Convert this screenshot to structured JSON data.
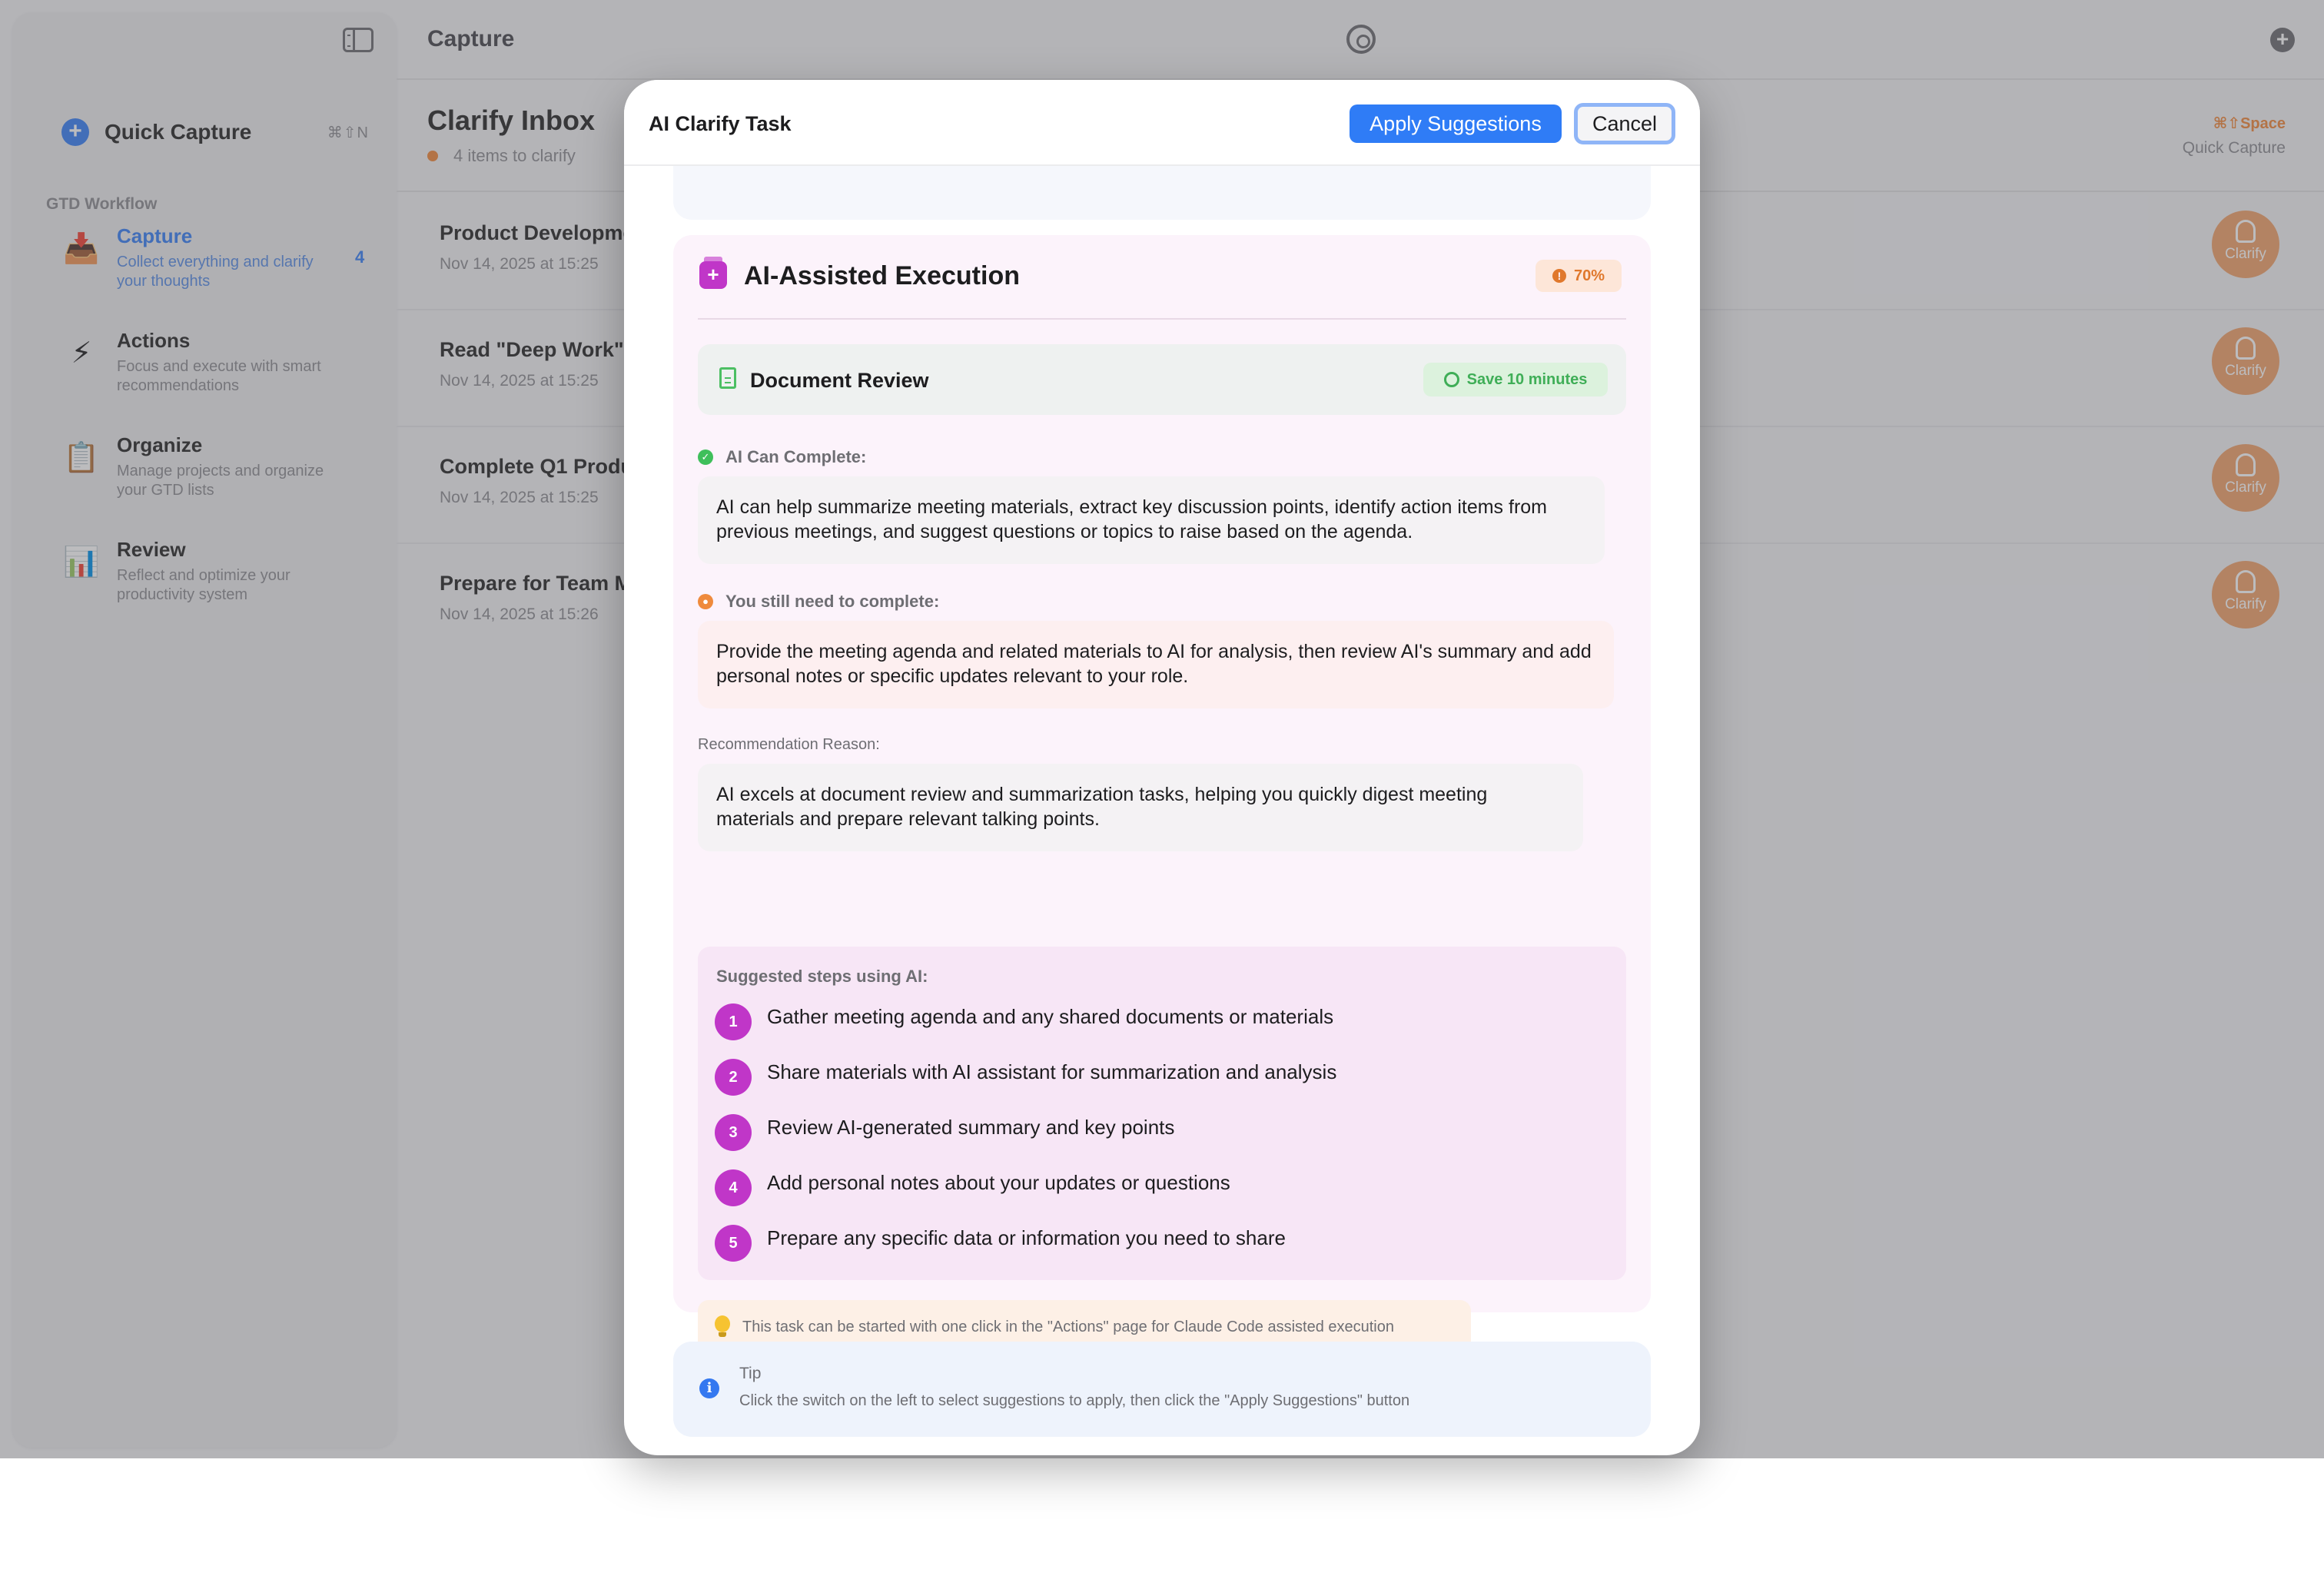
{
  "app": {
    "header_title": "Capture",
    "sidebar": {
      "quick_capture_label": "Quick Capture",
      "quick_capture_shortcut": "⌘⇧N",
      "section_label": "GTD Workflow",
      "items": [
        {
          "title": "Capture",
          "desc": "Collect everything and clarify your thoughts",
          "badge": "4",
          "icon": "inbox-icon"
        },
        {
          "title": "Actions",
          "desc": "Focus and execute with smart recommendations",
          "icon": "lightning-icon"
        },
        {
          "title": "Organize",
          "desc": "Manage projects and organize your GTD lists",
          "icon": "clipboard-icon"
        },
        {
          "title": "Review",
          "desc": "Reflect and optimize your productivity system",
          "icon": "bar-chart-icon"
        }
      ]
    },
    "inbox": {
      "title": "Clarify Inbox",
      "subtitle": "4 items to clarify",
      "quick_capture_hint_key": "⌘⇧Space",
      "quick_capture_hint_label": "Quick Capture",
      "clarify_label": "Clarify",
      "items": [
        {
          "title": "Product Developme",
          "date": "Nov 14, 2025 at 15:25"
        },
        {
          "title": "Read \"Deep Work\"",
          "date": "Nov 14, 2025 at 15:25"
        },
        {
          "title": "Complete Q1 Produ",
          "date": "Nov 14, 2025 at 15:25"
        },
        {
          "title": "Prepare for Team M",
          "date": "Nov 14, 2025 at 15:26"
        }
      ]
    }
  },
  "modal": {
    "title": "AI Clarify Task",
    "apply_label": "Apply Suggestions",
    "cancel_label": "Cancel",
    "ai_section": {
      "title": "AI-Assisted Execution",
      "confidence": "70%",
      "task_type": "Document Review",
      "time_saved": "Save 10 minutes",
      "ai_can_label": "AI Can Complete:",
      "ai_can_text": "AI can help summarize meeting materials, extract key discussion points, identify action items from previous meetings, and suggest questions or topics to raise based on the agenda.",
      "you_need_label": "You still need to complete:",
      "you_need_text": "Provide the meeting agenda and related materials to AI for analysis, then review AI's summary and add personal notes or specific updates relevant to your role.",
      "reason_label": "Recommendation Reason:",
      "reason_text": "AI excels at document review and summarization tasks, helping you quickly digest meeting materials and prepare relevant talking points.",
      "steps_label": "Suggested steps using AI:",
      "steps": [
        {
          "num": "1",
          "text": "Gather meeting agenda and any shared documents or materials"
        },
        {
          "num": "2",
          "text": "Share materials with AI assistant for summarization and analysis"
        },
        {
          "num": "3",
          "text": "Review AI-generated summary and key points"
        },
        {
          "num": "4",
          "text": "Add personal notes about your updates or questions"
        },
        {
          "num": "5",
          "text": "Prepare any specific data or information you need to share"
        }
      ],
      "note": "This task can be started with one click in the \"Actions\" page for Claude Code assisted execution"
    },
    "tip": {
      "title": "Tip",
      "text": "Click the switch on the left to select suggestions to apply, then click the \"Apply Suggestions\" button"
    }
  },
  "colors": {
    "accent_blue": "#2f7cf6",
    "ai_purple": "#c036c8",
    "warning_orange": "#e0782c",
    "success_green": "#3fae57"
  }
}
